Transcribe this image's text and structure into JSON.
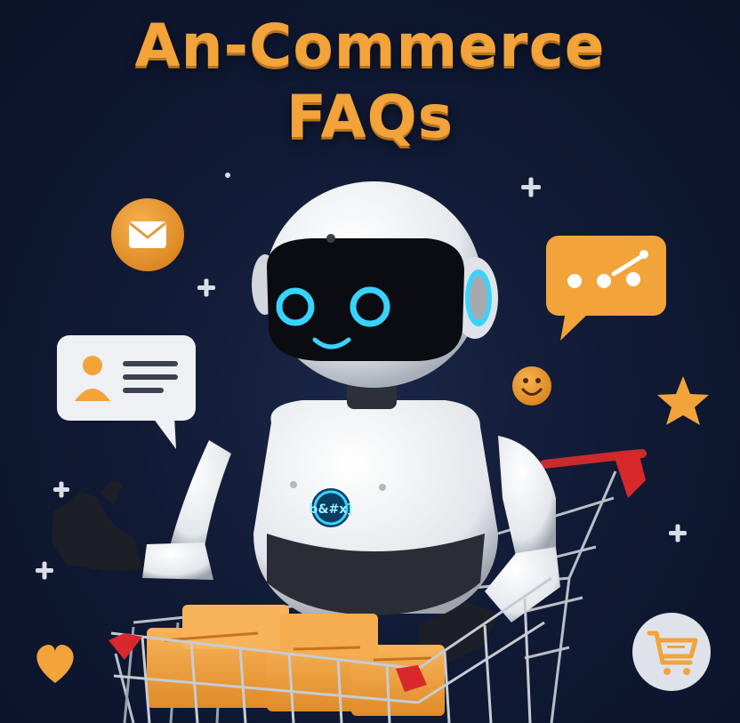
{
  "poster": {
    "title_line1": "An-Commerce",
    "title_line2": "FAQs",
    "robot_badge_text": "b&#x]"
  },
  "colors": {
    "background": "#0e1730",
    "accent_orange": "#f2a33a",
    "robot_white": "#eef0f3",
    "visor_glow": "#37d4ff",
    "cart_red": "#d8282c"
  },
  "icons": [
    "email-icon",
    "chat-bubble-icon",
    "user-profile-icon",
    "smiley-icon",
    "star-icon",
    "heart-icon",
    "shopping-cart-icon",
    "sparkle-icon"
  ]
}
